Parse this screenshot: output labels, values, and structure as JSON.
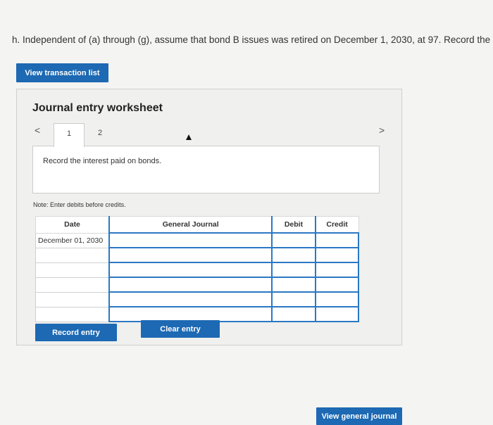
{
  "question": {
    "text": "h. Independent of (a) through (g), assume that bond B issues was retired on December 1, 2030, at 97. Record the entrie"
  },
  "buttons": {
    "view_transactions": "View transaction list",
    "record_entry": "Record entry",
    "clear_entry": "Clear entry",
    "view_general_journal": "View general journal"
  },
  "worksheet": {
    "title": "Journal entry worksheet",
    "nav_prev": "<",
    "nav_next": ">",
    "tabs": [
      {
        "label": "1"
      },
      {
        "label": "2"
      }
    ],
    "instruction": "Record the interest paid on bonds.",
    "note": "Note: Enter debits before credits."
  },
  "journal": {
    "headers": {
      "date": "Date",
      "general_journal": "General Journal",
      "debit": "Debit",
      "credit": "Credit"
    },
    "rows": [
      {
        "date": "December 01, 2030",
        "account": "",
        "debit": "",
        "credit": ""
      },
      {
        "date": "",
        "account": "",
        "debit": "",
        "credit": ""
      },
      {
        "date": "",
        "account": "",
        "debit": "",
        "credit": ""
      },
      {
        "date": "",
        "account": "",
        "debit": "",
        "credit": ""
      },
      {
        "date": "",
        "account": "",
        "debit": "",
        "credit": ""
      },
      {
        "date": "",
        "account": "",
        "debit": "",
        "credit": ""
      }
    ]
  }
}
